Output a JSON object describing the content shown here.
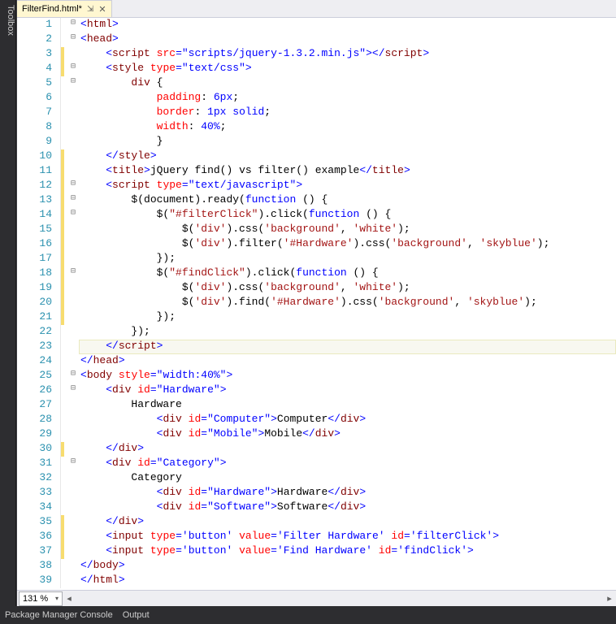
{
  "toolbox": {
    "label": "Toolbox"
  },
  "tab": {
    "title": "FilterFind.html*",
    "pin": "⇲",
    "close": "✕"
  },
  "zoom": {
    "value": "131 %"
  },
  "status": {
    "pmc": "Package Manager Console",
    "output": "Output"
  },
  "fold": {
    "minus": "⊟",
    "none": ""
  },
  "lines": [
    {
      "n": 1,
      "mod": false,
      "fold": "minus",
      "ind": 0,
      "tokens": [
        [
          "punct",
          "<"
        ],
        [
          "tag",
          "html"
        ],
        [
          "punct",
          ">"
        ]
      ]
    },
    {
      "n": 2,
      "mod": false,
      "fold": "minus",
      "ind": 0,
      "tokens": [
        [
          "punct",
          "<"
        ],
        [
          "tag",
          "head"
        ],
        [
          "punct",
          ">"
        ]
      ]
    },
    {
      "n": 3,
      "mod": true,
      "fold": "none",
      "ind": 1,
      "tokens": [
        [
          "punct",
          "<"
        ],
        [
          "tag",
          "script"
        ],
        [
          "plain",
          " "
        ],
        [
          "attr",
          "src"
        ],
        [
          "punct",
          "="
        ],
        [
          "val",
          "\"scripts/jquery-1.3.2.min.js\""
        ],
        [
          "punct",
          "></"
        ],
        [
          "tag",
          "script"
        ],
        [
          "punct",
          ">"
        ]
      ]
    },
    {
      "n": 4,
      "mod": true,
      "fold": "minus",
      "ind": 1,
      "tokens": [
        [
          "punct",
          "<"
        ],
        [
          "tag",
          "style"
        ],
        [
          "plain",
          " "
        ],
        [
          "attr",
          "type"
        ],
        [
          "punct",
          "="
        ],
        [
          "val",
          "\"text/css\""
        ],
        [
          "punct",
          ">"
        ]
      ]
    },
    {
      "n": 5,
      "mod": false,
      "fold": "minus",
      "ind": 2,
      "tokens": [
        [
          "tag",
          "div"
        ],
        [
          "plain",
          " {"
        ]
      ]
    },
    {
      "n": 6,
      "mod": false,
      "fold": "none",
      "ind": 3,
      "tokens": [
        [
          "css-prop",
          "padding"
        ],
        [
          "plain",
          ": "
        ],
        [
          "css-val",
          "6px"
        ],
        [
          "plain",
          ";"
        ]
      ]
    },
    {
      "n": 7,
      "mod": false,
      "fold": "none",
      "ind": 3,
      "tokens": [
        [
          "css-prop",
          "border"
        ],
        [
          "plain",
          ": "
        ],
        [
          "css-val",
          "1px"
        ],
        [
          "plain",
          " "
        ],
        [
          "css-val",
          "solid"
        ],
        [
          "plain",
          ";"
        ]
      ]
    },
    {
      "n": 8,
      "mod": false,
      "fold": "none",
      "ind": 3,
      "tokens": [
        [
          "css-prop",
          "width"
        ],
        [
          "plain",
          ": "
        ],
        [
          "css-val",
          "40%"
        ],
        [
          "plain",
          ";"
        ]
      ]
    },
    {
      "n": 9,
      "mod": false,
      "fold": "none",
      "ind": 3,
      "tokens": [
        [
          "plain",
          "}"
        ]
      ]
    },
    {
      "n": 10,
      "mod": true,
      "fold": "none",
      "ind": 1,
      "tokens": [
        [
          "punct",
          "</"
        ],
        [
          "tag",
          "style"
        ],
        [
          "punct",
          ">"
        ]
      ]
    },
    {
      "n": 11,
      "mod": true,
      "fold": "none",
      "ind": 1,
      "tokens": [
        [
          "punct",
          "<"
        ],
        [
          "tag",
          "title"
        ],
        [
          "punct",
          ">"
        ],
        [
          "plain",
          "jQuery find() vs filter() example"
        ],
        [
          "punct",
          "</"
        ],
        [
          "tag",
          "title"
        ],
        [
          "punct",
          ">"
        ]
      ]
    },
    {
      "n": 12,
      "mod": true,
      "fold": "minus",
      "ind": 1,
      "tokens": [
        [
          "punct",
          "<"
        ],
        [
          "tag",
          "script"
        ],
        [
          "plain",
          " "
        ],
        [
          "attr",
          "type"
        ],
        [
          "punct",
          "="
        ],
        [
          "val",
          "\"text/javascript\""
        ],
        [
          "punct",
          ">"
        ]
      ]
    },
    {
      "n": 13,
      "mod": true,
      "fold": "minus",
      "ind": 2,
      "tokens": [
        [
          "plain",
          "$(document).ready("
        ],
        [
          "kw",
          "function"
        ],
        [
          "plain",
          " () {"
        ]
      ]
    },
    {
      "n": 14,
      "mod": true,
      "fold": "minus",
      "ind": 3,
      "tokens": [
        [
          "plain",
          "$("
        ],
        [
          "str",
          "\"#filterClick\""
        ],
        [
          "plain",
          ").click("
        ],
        [
          "kw",
          "function"
        ],
        [
          "plain",
          " () {"
        ]
      ]
    },
    {
      "n": 15,
      "mod": true,
      "fold": "none",
      "ind": 4,
      "tokens": [
        [
          "plain",
          "$("
        ],
        [
          "str",
          "'div'"
        ],
        [
          "plain",
          ").css("
        ],
        [
          "str",
          "'background'"
        ],
        [
          "plain",
          ", "
        ],
        [
          "str",
          "'white'"
        ],
        [
          "plain",
          ");"
        ]
      ]
    },
    {
      "n": 16,
      "mod": true,
      "fold": "none",
      "ind": 4,
      "tokens": [
        [
          "plain",
          "$("
        ],
        [
          "str",
          "'div'"
        ],
        [
          "plain",
          ").filter("
        ],
        [
          "str",
          "'#Hardware'"
        ],
        [
          "plain",
          ").css("
        ],
        [
          "str",
          "'background'"
        ],
        [
          "plain",
          ", "
        ],
        [
          "str",
          "'skyblue'"
        ],
        [
          "plain",
          ");"
        ]
      ]
    },
    {
      "n": 17,
      "mod": true,
      "fold": "none",
      "ind": 3,
      "tokens": [
        [
          "plain",
          "});"
        ]
      ]
    },
    {
      "n": 18,
      "mod": true,
      "fold": "minus",
      "ind": 3,
      "tokens": [
        [
          "plain",
          "$("
        ],
        [
          "str",
          "\"#findClick\""
        ],
        [
          "plain",
          ").click("
        ],
        [
          "kw",
          "function"
        ],
        [
          "plain",
          " () {"
        ]
      ]
    },
    {
      "n": 19,
      "mod": true,
      "fold": "none",
      "ind": 4,
      "tokens": [
        [
          "plain",
          "$("
        ],
        [
          "str",
          "'div'"
        ],
        [
          "plain",
          ").css("
        ],
        [
          "str",
          "'background'"
        ],
        [
          "plain",
          ", "
        ],
        [
          "str",
          "'white'"
        ],
        [
          "plain",
          ");"
        ]
      ]
    },
    {
      "n": 20,
      "mod": true,
      "fold": "none",
      "ind": 4,
      "tokens": [
        [
          "plain",
          "$("
        ],
        [
          "str",
          "'div'"
        ],
        [
          "plain",
          ").find("
        ],
        [
          "str",
          "'#Hardware'"
        ],
        [
          "plain",
          ").css("
        ],
        [
          "str",
          "'background'"
        ],
        [
          "plain",
          ", "
        ],
        [
          "str",
          "'skyblue'"
        ],
        [
          "plain",
          ");"
        ]
      ]
    },
    {
      "n": 21,
      "mod": true,
      "fold": "none",
      "ind": 3,
      "tokens": [
        [
          "plain",
          "});"
        ]
      ]
    },
    {
      "n": 22,
      "mod": false,
      "fold": "none",
      "ind": 2,
      "tokens": [
        [
          "plain",
          "});"
        ]
      ]
    },
    {
      "n": 23,
      "mod": false,
      "fold": "none",
      "ind": 1,
      "current": true,
      "tokens": [
        [
          "punct",
          "</"
        ],
        [
          "tag",
          "script"
        ],
        [
          "punct",
          ">"
        ]
      ]
    },
    {
      "n": 24,
      "mod": false,
      "fold": "none",
      "ind": 0,
      "tokens": [
        [
          "punct",
          "</"
        ],
        [
          "tag",
          "head"
        ],
        [
          "punct",
          ">"
        ]
      ]
    },
    {
      "n": 25,
      "mod": false,
      "fold": "minus",
      "ind": 0,
      "tokens": [
        [
          "punct",
          "<"
        ],
        [
          "tag",
          "body"
        ],
        [
          "plain",
          " "
        ],
        [
          "attr",
          "style"
        ],
        [
          "punct",
          "="
        ],
        [
          "val",
          "\"width:40%\""
        ],
        [
          "punct",
          ">"
        ]
      ]
    },
    {
      "n": 26,
      "mod": false,
      "fold": "minus",
      "ind": 1,
      "tokens": [
        [
          "punct",
          "<"
        ],
        [
          "tag",
          "div"
        ],
        [
          "plain",
          " "
        ],
        [
          "attr",
          "id"
        ],
        [
          "punct",
          "="
        ],
        [
          "val",
          "\"Hardware\""
        ],
        [
          "punct",
          ">"
        ]
      ]
    },
    {
      "n": 27,
      "mod": false,
      "fold": "none",
      "ind": 2,
      "tokens": [
        [
          "plain",
          "Hardware"
        ]
      ]
    },
    {
      "n": 28,
      "mod": false,
      "fold": "none",
      "ind": 3,
      "tokens": [
        [
          "punct",
          "<"
        ],
        [
          "tag",
          "div"
        ],
        [
          "plain",
          " "
        ],
        [
          "attr",
          "id"
        ],
        [
          "punct",
          "="
        ],
        [
          "val",
          "\"Computer\""
        ],
        [
          "punct",
          ">"
        ],
        [
          "plain",
          "Computer"
        ],
        [
          "punct",
          "</"
        ],
        [
          "tag",
          "div"
        ],
        [
          "punct",
          ">"
        ]
      ]
    },
    {
      "n": 29,
      "mod": false,
      "fold": "none",
      "ind": 3,
      "tokens": [
        [
          "punct",
          "<"
        ],
        [
          "tag",
          "div"
        ],
        [
          "plain",
          " "
        ],
        [
          "attr",
          "id"
        ],
        [
          "punct",
          "="
        ],
        [
          "val",
          "\"Mobile\""
        ],
        [
          "punct",
          ">"
        ],
        [
          "plain",
          "Mobile"
        ],
        [
          "punct",
          "</"
        ],
        [
          "tag",
          "div"
        ],
        [
          "punct",
          ">"
        ]
      ]
    },
    {
      "n": 30,
      "mod": true,
      "fold": "none",
      "ind": 1,
      "tokens": [
        [
          "punct",
          "</"
        ],
        [
          "tag",
          "div"
        ],
        [
          "punct",
          ">"
        ]
      ]
    },
    {
      "n": 31,
      "mod": false,
      "fold": "minus",
      "ind": 1,
      "tokens": [
        [
          "punct",
          "<"
        ],
        [
          "tag",
          "div"
        ],
        [
          "plain",
          " "
        ],
        [
          "attr",
          "id"
        ],
        [
          "punct",
          "="
        ],
        [
          "val",
          "\"Category\""
        ],
        [
          "punct",
          ">"
        ]
      ]
    },
    {
      "n": 32,
      "mod": false,
      "fold": "none",
      "ind": 2,
      "tokens": [
        [
          "plain",
          "Category"
        ]
      ]
    },
    {
      "n": 33,
      "mod": false,
      "fold": "none",
      "ind": 3,
      "tokens": [
        [
          "punct",
          "<"
        ],
        [
          "tag",
          "div"
        ],
        [
          "plain",
          " "
        ],
        [
          "attr",
          "id"
        ],
        [
          "punct",
          "="
        ],
        [
          "val",
          "\"Hardware\""
        ],
        [
          "punct",
          ">"
        ],
        [
          "plain",
          "Hardware"
        ],
        [
          "punct",
          "</"
        ],
        [
          "tag",
          "div"
        ],
        [
          "punct",
          ">"
        ]
      ]
    },
    {
      "n": 34,
      "mod": false,
      "fold": "none",
      "ind": 3,
      "tokens": [
        [
          "punct",
          "<"
        ],
        [
          "tag",
          "div"
        ],
        [
          "plain",
          " "
        ],
        [
          "attr",
          "id"
        ],
        [
          "punct",
          "="
        ],
        [
          "val",
          "\"Software\""
        ],
        [
          "punct",
          ">"
        ],
        [
          "plain",
          "Software"
        ],
        [
          "punct",
          "</"
        ],
        [
          "tag",
          "div"
        ],
        [
          "punct",
          ">"
        ]
      ]
    },
    {
      "n": 35,
      "mod": true,
      "fold": "none",
      "ind": 1,
      "tokens": [
        [
          "punct",
          "</"
        ],
        [
          "tag",
          "div"
        ],
        [
          "punct",
          ">"
        ]
      ]
    },
    {
      "n": 36,
      "mod": true,
      "fold": "none",
      "ind": 1,
      "tokens": [
        [
          "punct",
          "<"
        ],
        [
          "tag",
          "input"
        ],
        [
          "plain",
          " "
        ],
        [
          "attr",
          "type"
        ],
        [
          "punct",
          "="
        ],
        [
          "val",
          "'button'"
        ],
        [
          "plain",
          " "
        ],
        [
          "attr",
          "value"
        ],
        [
          "punct",
          "="
        ],
        [
          "val",
          "'Filter Hardware'"
        ],
        [
          "plain",
          " "
        ],
        [
          "attr",
          "id"
        ],
        [
          "punct",
          "="
        ],
        [
          "val",
          "'filterClick'"
        ],
        [
          "punct",
          ">"
        ]
      ]
    },
    {
      "n": 37,
      "mod": true,
      "fold": "none",
      "ind": 1,
      "tokens": [
        [
          "punct",
          "<"
        ],
        [
          "tag",
          "input"
        ],
        [
          "plain",
          " "
        ],
        [
          "attr",
          "type"
        ],
        [
          "punct",
          "="
        ],
        [
          "val",
          "'button'"
        ],
        [
          "plain",
          " "
        ],
        [
          "attr",
          "value"
        ],
        [
          "punct",
          "="
        ],
        [
          "val",
          "'Find Hardware'"
        ],
        [
          "plain",
          " "
        ],
        [
          "attr",
          "id"
        ],
        [
          "punct",
          "="
        ],
        [
          "val",
          "'findClick'"
        ],
        [
          "punct",
          ">"
        ]
      ]
    },
    {
      "n": 38,
      "mod": false,
      "fold": "none",
      "ind": 0,
      "tokens": [
        [
          "punct",
          "</"
        ],
        [
          "tag",
          "body"
        ],
        [
          "punct",
          ">"
        ]
      ]
    },
    {
      "n": 39,
      "mod": false,
      "fold": "none",
      "ind": 0,
      "tokens": [
        [
          "punct",
          "</"
        ],
        [
          "tag",
          "html"
        ],
        [
          "punct",
          ">"
        ]
      ]
    }
  ]
}
